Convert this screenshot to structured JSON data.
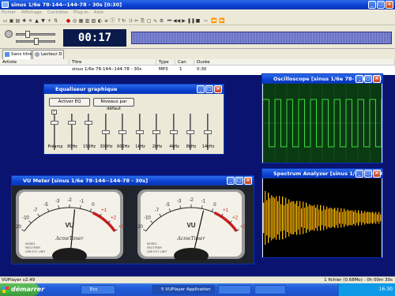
{
  "app": {
    "title": "sinus 1/6e 78-144--144-78 - 30s [0:30]"
  },
  "menu": [
    "Fichier",
    "Affichage",
    "Contrôles",
    "Plug-in",
    "Aide"
  ],
  "player": {
    "time": "00:17",
    "volume_level": 0.25,
    "seek_fraction": 0.0
  },
  "tabs": [
    "Sans titre",
    "Lecteur D"
  ],
  "playlist": {
    "columns": [
      "Artiste",
      "Titre",
      "Type",
      "Can",
      "Durée"
    ],
    "rows": [
      {
        "artist": "",
        "title": "sinus 1/6e 78-144--144-78 - 30s",
        "type": "MP3",
        "channels": "1",
        "duration": "0:30"
      }
    ]
  },
  "equalizer": {
    "title": "Equaliseur graphique",
    "activate_label": "Activer EQ",
    "default_label": "Niveaux par défaut",
    "bands": [
      {
        "label": "Préamp",
        "level": 0.78,
        "checked": true
      },
      {
        "label": "80Hz",
        "level": 0.78
      },
      {
        "label": "150Hz",
        "level": 0.78
      },
      {
        "label": "300Hz",
        "level": 0.5
      },
      {
        "label": "600Hz",
        "level": 0.5
      },
      {
        "label": "1kHz",
        "level": 0.5
      },
      {
        "label": "2kHz",
        "level": 0.5
      },
      {
        "label": "4kHz",
        "level": 0.5
      },
      {
        "label": "8kHz",
        "level": 0.5
      },
      {
        "label": "14kHz",
        "level": 0.5
      }
    ]
  },
  "oscilloscope": {
    "title": "Oscilloscope [sinus 1/6e 78-144--144-78 - 30s]"
  },
  "spectrum": {
    "title": "Spectrum Analyzer [sinus 1/6e 78-144--144-78 - 30s]"
  },
  "vumeter": {
    "title": "VU Meter [sinus 1/6e 78-144--144-78 - 30s]",
    "scale": [
      "-20",
      "-10",
      "-7",
      "-5",
      "-3",
      "-2",
      "-1",
      "0",
      "+1",
      "+2",
      "+3"
    ],
    "unit_label": "VU",
    "brand": "AcmeTimer",
    "fine_print": [
      "MODEL",
      "RECTIFIER",
      "USE EXT. UNIT"
    ],
    "needle_values": [
      0.55,
      0.62
    ]
  },
  "status": {
    "left": "VUPlayer v2.49",
    "right": "1 fichier (0.68Mo) : 0h 00m 30s"
  },
  "taskbar": {
    "start": "démarrer",
    "tasks": [
      "Ecc",
      "5 VUPlayer Application",
      "",
      ""
    ],
    "clock": "16:30"
  },
  "colors": {
    "accent": "#245edb",
    "desktop": "#0a1470",
    "scope_bg": "#0a3a12",
    "spectrum": "#f0a000"
  }
}
